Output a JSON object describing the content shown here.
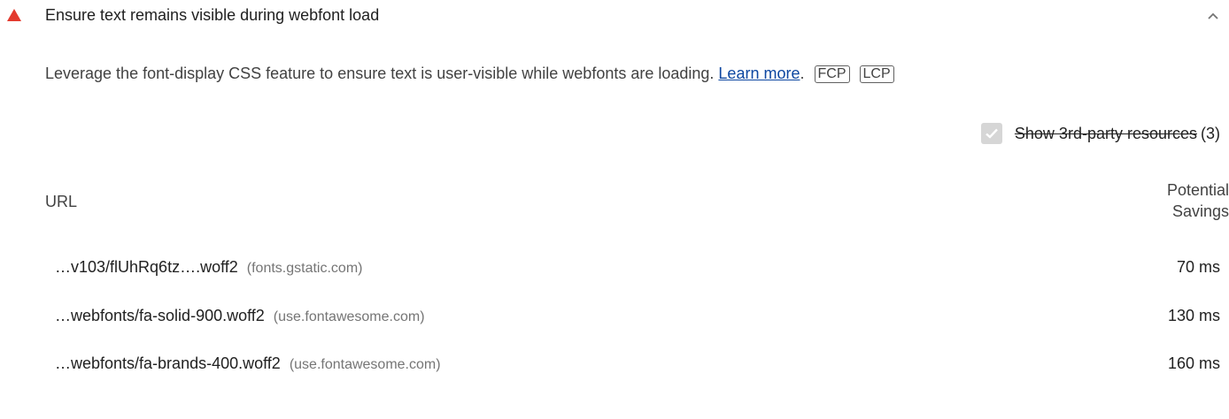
{
  "audit": {
    "status_color": "#e33b2f",
    "status_icon": "warning-triangle-icon",
    "title": "Ensure text remains visible during webfont load",
    "collapse_icon": "chevron-up-icon"
  },
  "description": {
    "text": "Leverage the font-display CSS feature to ensure text is user-visible while webfonts are loading. ",
    "link_label": "Learn more",
    "after_link": ".",
    "tags": [
      "FCP",
      "LCP"
    ]
  },
  "third_party": {
    "label": "Show 3rd-party resources",
    "count": "(3)",
    "checked": true
  },
  "table": {
    "columns": {
      "url": "URL",
      "savings_line1": "Potential",
      "savings_line2": "Savings"
    },
    "rows": [
      {
        "url": "…v103/flUhRq6tz….woff2",
        "domain": "(fonts.gstatic.com)",
        "savings": "70 ms"
      },
      {
        "url": "…webfonts/fa-solid-900.woff2",
        "domain": "(use.fontawesome.com)",
        "savings": "130 ms"
      },
      {
        "url": "…webfonts/fa-brands-400.woff2",
        "domain": "(use.fontawesome.com)",
        "savings": "160 ms"
      }
    ]
  }
}
